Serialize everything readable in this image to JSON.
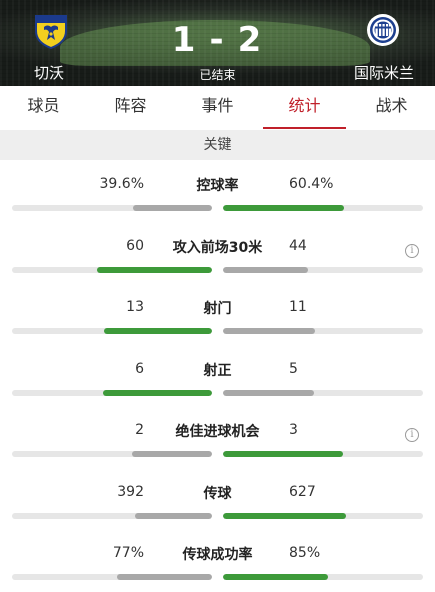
{
  "match": {
    "home_team": "切沃",
    "away_team": "国际米兰",
    "home_score": "1",
    "away_score": "2",
    "separator": "-",
    "status": "已结束"
  },
  "tabs": [
    {
      "label": "球员",
      "active": false
    },
    {
      "label": "阵容",
      "active": false
    },
    {
      "label": "事件",
      "active": false
    },
    {
      "label": "统计",
      "active": true
    },
    {
      "label": "战术",
      "active": false
    }
  ],
  "section_title": "关键",
  "info_icon_glyph": "i",
  "colors": {
    "accent": "#c0202a",
    "winner_bar": "#3d9a3a",
    "loser_bar": "#a8a8a8",
    "track": "#e6e6e6"
  },
  "stats": [
    {
      "label": "控球率",
      "home": "39.6%",
      "away": "60.4%",
      "home_frac": 0.396,
      "away_frac": 0.604,
      "info": false
    },
    {
      "label": "攻入前场30米",
      "home": "60",
      "away": "44",
      "home_frac": 0.577,
      "away_frac": 0.423,
      "info": true
    },
    {
      "label": "射门",
      "home": "13",
      "away": "11",
      "home_frac": 0.542,
      "away_frac": 0.458,
      "info": false
    },
    {
      "label": "射正",
      "home": "6",
      "away": "5",
      "home_frac": 0.545,
      "away_frac": 0.455,
      "info": false
    },
    {
      "label": "绝佳进球机会",
      "home": "2",
      "away": "3",
      "home_frac": 0.4,
      "away_frac": 0.6,
      "info": true
    },
    {
      "label": "传球",
      "home": "392",
      "away": "627",
      "home_frac": 0.385,
      "away_frac": 0.615,
      "info": false
    },
    {
      "label": "传球成功率",
      "home": "77%",
      "away": "85%",
      "home_frac": 0.475,
      "away_frac": 0.525,
      "info": false
    }
  ]
}
